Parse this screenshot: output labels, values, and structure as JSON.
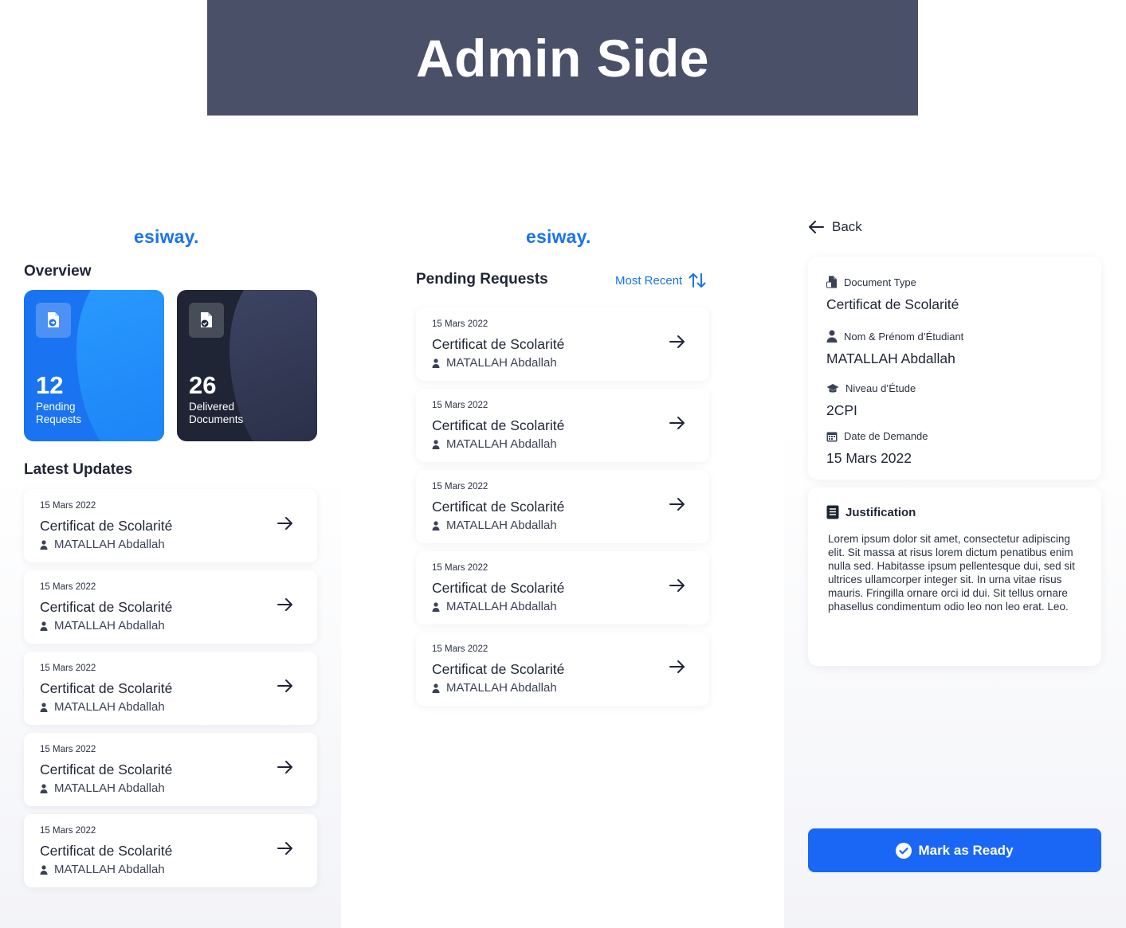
{
  "banner": {
    "title": "Admin Side"
  },
  "brand": {
    "logo": "esiway."
  },
  "dashboard": {
    "overview_title": "Overview",
    "cards": [
      {
        "count": "12",
        "label": "Pending Requests",
        "icon": "document-arrow-icon"
      },
      {
        "count": "26",
        "label": "Delivered Documents",
        "icon": "document-check-icon"
      }
    ],
    "updates_title": "Latest Updates",
    "items": [
      {
        "date": "15 Mars 2022",
        "title": "Certificat de Scolarité",
        "student": "MATALLAH Abdallah"
      },
      {
        "date": "15 Mars 2022",
        "title": "Certificat de Scolarité",
        "student": "MATALLAH Abdallah"
      },
      {
        "date": "15 Mars 2022",
        "title": "Certificat de Scolarité",
        "student": "MATALLAH Abdallah"
      },
      {
        "date": "15 Mars 2022",
        "title": "Certificat de Scolarité",
        "student": "MATALLAH Abdallah"
      },
      {
        "date": "15 Mars 2022",
        "title": "Certificat de Scolarité",
        "student": "MATALLAH Abdallah"
      }
    ]
  },
  "pending": {
    "title": "Pending Requests",
    "sort_label": "Most Recent",
    "items": [
      {
        "date": "15 Mars 2022",
        "title": "Certificat de Scolarité",
        "student": "MATALLAH Abdallah"
      },
      {
        "date": "15 Mars 2022",
        "title": "Certificat de Scolarité",
        "student": "MATALLAH Abdallah"
      },
      {
        "date": "15 Mars 2022",
        "title": "Certificat de Scolarité",
        "student": "MATALLAH Abdallah"
      },
      {
        "date": "15 Mars 2022",
        "title": "Certificat de Scolarité",
        "student": "MATALLAH Abdallah"
      },
      {
        "date": "15 Mars 2022",
        "title": "Certificat de Scolarité",
        "student": "MATALLAH Abdallah"
      }
    ]
  },
  "detail": {
    "back_label": "Back",
    "fields": [
      {
        "label": "Document Type",
        "value": "Certificat de Scolarité",
        "icon": "document-icon"
      },
      {
        "label": "Nom & Prénom d’Étudiant",
        "value": "MATALLAH Abdallah",
        "icon": "user-icon"
      },
      {
        "label": "Niveau d’Étude",
        "value": "2CPI",
        "icon": "graduation-cap-icon"
      },
      {
        "label": "Date de Demande",
        "value": "15 Mars 2022",
        "icon": "calendar-icon"
      }
    ],
    "justification_title": "Justification",
    "justification_text": "Lorem ipsum dolor sit amet, consectetur adipiscing elit. Sit massa at risus lorem dictum penatibus enim nulla sed. Habitasse ipsum pellentesque dui, sed sit ultrices ullamcorper integer sit. In urna vitae risus mauris. Fringilla ornare orci id dui. Sit tellus ornare phasellus condimentum odio leo non leo erat. Leo.",
    "action_label": "Mark as Ready"
  },
  "colors": {
    "primary": "#1a73f0",
    "dark": "#1f2535",
    "banner": "#4a5068",
    "button": "#1a66f5"
  }
}
